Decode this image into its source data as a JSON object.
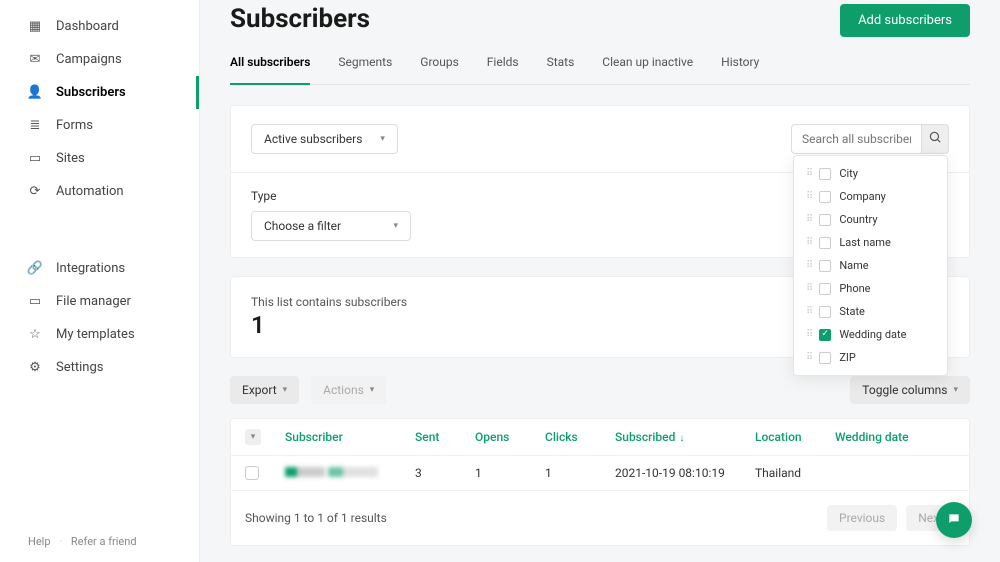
{
  "sidebar": {
    "items": [
      {
        "icon": "dashboard",
        "label": "Dashboard"
      },
      {
        "icon": "campaigns",
        "label": "Campaigns"
      },
      {
        "icon": "subscribers",
        "label": "Subscribers",
        "active": true
      },
      {
        "icon": "forms",
        "label": "Forms"
      },
      {
        "icon": "sites",
        "label": "Sites"
      },
      {
        "icon": "automation",
        "label": "Automation"
      }
    ],
    "items2": [
      {
        "icon": "integrations",
        "label": "Integrations"
      },
      {
        "icon": "filemanager",
        "label": "File manager"
      },
      {
        "icon": "templates",
        "label": "My templates"
      },
      {
        "icon": "settings",
        "label": "Settings"
      }
    ],
    "footer": {
      "help": "Help",
      "refer": "Refer a friend"
    }
  },
  "header": {
    "title": "Subscribers",
    "add_button": "Add subscribers"
  },
  "tabs": [
    "All subscribers",
    "Segments",
    "Groups",
    "Fields",
    "Stats",
    "Clean up inactive",
    "History"
  ],
  "filter": {
    "status_dropdown": "Active subscribers",
    "search_placeholder": "Search all subscribers",
    "type_label": "Type",
    "type_dropdown": "Choose a filter"
  },
  "count": {
    "label": "This list contains subscribers",
    "value": "1"
  },
  "toolbar": {
    "export": "Export",
    "actions": "Actions",
    "toggle": "Toggle columns"
  },
  "columns_dropdown": [
    {
      "label": "City",
      "checked": false
    },
    {
      "label": "Company",
      "checked": false
    },
    {
      "label": "Country",
      "checked": false
    },
    {
      "label": "Last name",
      "checked": false
    },
    {
      "label": "Name",
      "checked": false
    },
    {
      "label": "Phone",
      "checked": false
    },
    {
      "label": "State",
      "checked": false
    },
    {
      "label": "Wedding date",
      "checked": true
    },
    {
      "label": "ZIP",
      "checked": false
    }
  ],
  "table": {
    "headers": {
      "subscriber": "Subscriber",
      "sent": "Sent",
      "opens": "Opens",
      "clicks": "Clicks",
      "subscribed": "Subscribed",
      "location": "Location",
      "wedding": "Wedding date"
    },
    "rows": [
      {
        "sent": "3",
        "opens": "1",
        "clicks": "1",
        "subscribed": "2021-10-19 08:10:19",
        "location": "Thailand",
        "wedding": ""
      }
    ],
    "footer": "Showing 1 to 1 of 1 results",
    "prev": "Previous",
    "next": "Next"
  }
}
